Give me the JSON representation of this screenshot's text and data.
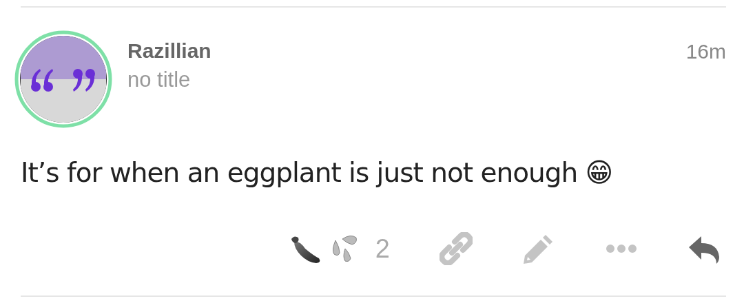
{
  "post": {
    "author": "Razillian",
    "subtitle": "no title",
    "time": "16m",
    "body": "It’s for when an eggplant is just not enough 😁",
    "reaction": {
      "count": "2"
    },
    "actions": [
      {
        "kind": "link"
      },
      {
        "kind": "edit"
      },
      {
        "kind": "more"
      },
      {
        "kind": "reply"
      }
    ]
  }
}
